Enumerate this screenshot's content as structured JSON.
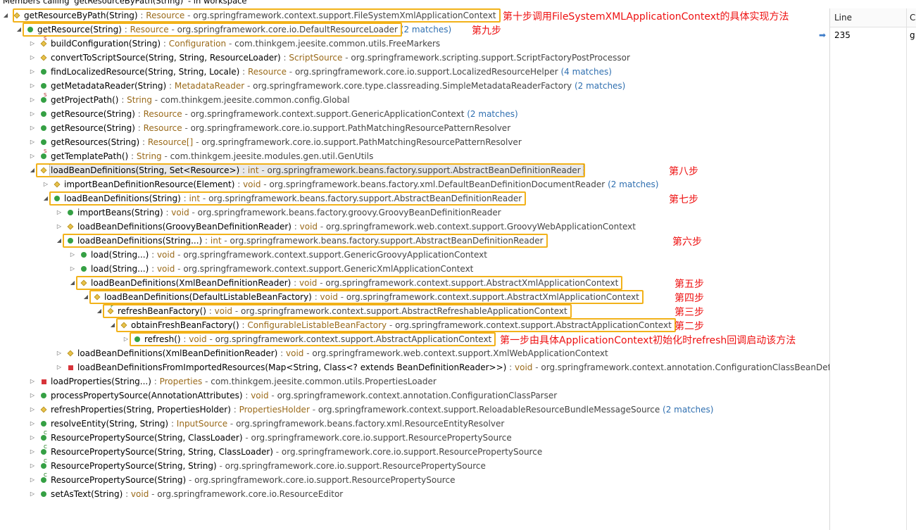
{
  "header": {
    "title": "Members calling 'getResourceByPath(String)' - in workspace"
  },
  "right_panel": {
    "col_line": "Line",
    "col_code": "C",
    "row_line": "235",
    "row_code": "g"
  },
  "rows": [
    {
      "indent": 0,
      "twisty": "open",
      "icon": "prot",
      "mod": "",
      "method": "getResourceByPath(String)",
      "ret": "Resource",
      "decl": "org.springframework.context.support.FileSystemXmlApplicationContext",
      "count": "",
      "hl": true
    },
    {
      "indent": 1,
      "twisty": "open",
      "icon": "pub",
      "mod": "",
      "method": "getResource(String)",
      "ret": "Resource",
      "decl": "org.springframework.core.io.DefaultResourceLoader",
      "count": "(2 matches)",
      "hl": true
    },
    {
      "indent": 2,
      "twisty": "closed",
      "icon": "prot",
      "mod": "S",
      "method": "buildConfiguration(String)",
      "ret": "Configuration",
      "decl": "com.thinkgem.jeesite.common.utils.FreeMarkers",
      "count": ""
    },
    {
      "indent": 2,
      "twisty": "closed",
      "icon": "prot",
      "mod": "",
      "method": "convertToScriptSource(String, String, ResourceLoader)",
      "ret": "ScriptSource",
      "decl": "org.springframework.scripting.support.ScriptFactoryPostProcessor",
      "count": ""
    },
    {
      "indent": 2,
      "twisty": "closed",
      "icon": "pub",
      "mod": "",
      "method": "findLocalizedResource(String, String, Locale)",
      "ret": "Resource",
      "decl": "org.springframework.core.io.support.LocalizedResourceHelper",
      "count": "(4 matches)"
    },
    {
      "indent": 2,
      "twisty": "closed",
      "icon": "pub",
      "mod": "",
      "method": "getMetadataReader(String)",
      "ret": "MetadataReader",
      "decl": "org.springframework.core.type.classreading.SimpleMetadataReaderFactory",
      "count": "(2 matches)"
    },
    {
      "indent": 2,
      "twisty": "closed",
      "icon": "pub",
      "mod": "S",
      "method": "getProjectPath()",
      "ret": "String",
      "decl": "com.thinkgem.jeesite.common.config.Global",
      "count": ""
    },
    {
      "indent": 2,
      "twisty": "closed",
      "icon": "pub",
      "mod": "",
      "method": "getResource(String)",
      "ret": "Resource",
      "decl": "org.springframework.context.support.GenericApplicationContext",
      "count": "(2 matches)"
    },
    {
      "indent": 2,
      "twisty": "closed",
      "icon": "pub",
      "mod": "",
      "method": "getResource(String)",
      "ret": "Resource",
      "decl": "org.springframework.core.io.support.PathMatchingResourcePatternResolver",
      "count": ""
    },
    {
      "indent": 2,
      "twisty": "closed",
      "icon": "pub",
      "mod": "",
      "method": "getResources(String)",
      "ret": "Resource[]",
      "decl": "org.springframework.core.io.support.PathMatchingResourcePatternResolver",
      "count": ""
    },
    {
      "indent": 2,
      "twisty": "closed",
      "icon": "pub",
      "mod": "S",
      "method": "getTemplatePath()",
      "ret": "String",
      "decl": "com.thinkgem.jeesite.modules.gen.util.GenUtils",
      "count": ""
    },
    {
      "indent": 2,
      "twisty": "open",
      "icon": "prot",
      "mod": "",
      "method": "loadBeanDefinitions(String, Set<Resource>)",
      "ret": "int",
      "decl": "org.springframework.beans.factory.support.AbstractBeanDefinitionReader",
      "count": "",
      "hl": true,
      "sel": true
    },
    {
      "indent": 3,
      "twisty": "closed",
      "icon": "prot",
      "mod": "",
      "method": "importBeanDefinitionResource(Element)",
      "ret": "void",
      "decl": "org.springframework.beans.factory.xml.DefaultBeanDefinitionDocumentReader",
      "count": "(2 matches)"
    },
    {
      "indent": 3,
      "twisty": "open",
      "icon": "pub",
      "mod": "",
      "method": "loadBeanDefinitions(String)",
      "ret": "int",
      "decl": "org.springframework.beans.factory.support.AbstractBeanDefinitionReader",
      "count": "",
      "hl": true
    },
    {
      "indent": 4,
      "twisty": "closed",
      "icon": "pub",
      "mod": "",
      "method": "importBeans(String)",
      "ret": "void",
      "decl": "org.springframework.beans.factory.groovy.GroovyBeanDefinitionReader",
      "count": ""
    },
    {
      "indent": 4,
      "twisty": "closed",
      "icon": "prot",
      "mod": "",
      "method": "loadBeanDefinitions(GroovyBeanDefinitionReader)",
      "ret": "void",
      "decl": "org.springframework.web.context.support.GroovyWebApplicationContext",
      "count": ""
    },
    {
      "indent": 4,
      "twisty": "open",
      "icon": "pub",
      "mod": "",
      "method": "loadBeanDefinitions(String...)",
      "ret": "int",
      "decl": "org.springframework.beans.factory.support.AbstractBeanDefinitionReader",
      "count": "",
      "hl": true
    },
    {
      "indent": 5,
      "twisty": "closed",
      "icon": "pub",
      "mod": "",
      "method": "load(String...)",
      "ret": "void",
      "decl": "org.springframework.context.support.GenericGroovyApplicationContext",
      "count": ""
    },
    {
      "indent": 5,
      "twisty": "closed",
      "icon": "pub",
      "mod": "",
      "method": "load(String...)",
      "ret": "void",
      "decl": "org.springframework.context.support.GenericXmlApplicationContext",
      "count": ""
    },
    {
      "indent": 5,
      "twisty": "open",
      "icon": "prot",
      "mod": "",
      "method": "loadBeanDefinitions(XmlBeanDefinitionReader)",
      "ret": "void",
      "decl": "org.springframework.context.support.AbstractXmlApplicationContext",
      "count": "",
      "hl": true
    },
    {
      "indent": 6,
      "twisty": "open",
      "icon": "prot",
      "mod": "",
      "method": "loadBeanDefinitions(DefaultListableBeanFactory)",
      "ret": "void",
      "decl": "org.springframework.context.support.AbstractXmlApplicationContext",
      "count": "",
      "hl": true
    },
    {
      "indent": 7,
      "twisty": "open",
      "icon": "prot",
      "mod": "F",
      "method": "refreshBeanFactory()",
      "ret": "void",
      "decl": "org.springframework.context.support.AbstractRefreshableApplicationContext",
      "count": "",
      "hl": true
    },
    {
      "indent": 8,
      "twisty": "open",
      "icon": "prot",
      "mod": "",
      "method": "obtainFreshBeanFactory()",
      "ret": "ConfigurableListableBeanFactory",
      "decl": "org.springframework.context.support.AbstractApplicationContext",
      "count": "",
      "hl": true
    },
    {
      "indent": 9,
      "twisty": "closed",
      "icon": "pub",
      "mod": "",
      "method": "refresh()",
      "ret": "void",
      "decl": "org.springframework.context.support.AbstractApplicationContext",
      "count": "",
      "hl": true
    },
    {
      "indent": 4,
      "twisty": "closed",
      "icon": "prot",
      "mod": "",
      "method": "loadBeanDefinitions(XmlBeanDefinitionReader)",
      "ret": "void",
      "decl": "org.springframework.web.context.support.XmlWebApplicationContext",
      "count": ""
    },
    {
      "indent": 4,
      "twisty": "closed",
      "icon": "priv",
      "mod": "",
      "method": "loadBeanDefinitionsFromImportedResources(Map<String, Class<? extends BeanDefinitionReader>>)",
      "ret": "void",
      "decl": "org.springframework.context.annotation.ConfigurationClassBeanDefi",
      "count": ""
    },
    {
      "indent": 2,
      "twisty": "closed",
      "icon": "priv",
      "mod": "",
      "method": "loadProperties(String...)",
      "ret": "Properties",
      "decl": "com.thinkgem.jeesite.common.utils.PropertiesLoader",
      "count": ""
    },
    {
      "indent": 2,
      "twisty": "closed",
      "icon": "pub",
      "mod": "",
      "method": "processPropertySource(AnnotationAttributes)",
      "ret": "void",
      "decl": "org.springframework.context.annotation.ConfigurationClassParser",
      "count": ""
    },
    {
      "indent": 2,
      "twisty": "closed",
      "icon": "prot",
      "mod": "",
      "method": "refreshProperties(String, PropertiesHolder)",
      "ret": "PropertiesHolder",
      "decl": "org.springframework.context.support.ReloadableResourceBundleMessageSource",
      "count": "(2 matches)"
    },
    {
      "indent": 2,
      "twisty": "closed",
      "icon": "pub",
      "mod": "",
      "method": "resolveEntity(String, String)",
      "ret": "InputSource",
      "decl": "org.springframework.beans.factory.xml.ResourceEntityResolver",
      "count": ""
    },
    {
      "indent": 2,
      "twisty": "closed",
      "icon": "pub",
      "mod": "C",
      "method": "ResourcePropertySource(String, ClassLoader)",
      "ret": "",
      "decl": "org.springframework.core.io.support.ResourcePropertySource",
      "count": ""
    },
    {
      "indent": 2,
      "twisty": "closed",
      "icon": "pub",
      "mod": "C",
      "method": "ResourcePropertySource(String, String, ClassLoader)",
      "ret": "",
      "decl": "org.springframework.core.io.support.ResourcePropertySource",
      "count": ""
    },
    {
      "indent": 2,
      "twisty": "closed",
      "icon": "pub",
      "mod": "C",
      "method": "ResourcePropertySource(String, String)",
      "ret": "",
      "decl": "org.springframework.core.io.support.ResourcePropertySource",
      "count": ""
    },
    {
      "indent": 2,
      "twisty": "closed",
      "icon": "pub",
      "mod": "C",
      "method": "ResourcePropertySource(String)",
      "ret": "",
      "decl": "org.springframework.core.io.support.ResourcePropertySource",
      "count": ""
    },
    {
      "indent": 2,
      "twisty": "closed",
      "icon": "pub",
      "mod": "",
      "method": "setAsText(String)",
      "ret": "void",
      "decl": "org.springframework.core.io.ResourceEditor",
      "count": ""
    }
  ],
  "annotations": [
    {
      "row": 0,
      "text": "第十步调用FileSystemXMLApplicationContext的具体实现方法"
    },
    {
      "row": 1,
      "text": "第九步"
    },
    {
      "row": 11,
      "text": "第八步"
    },
    {
      "row": 13,
      "text": "第七步"
    },
    {
      "row": 16,
      "text": "第六步"
    },
    {
      "row": 19,
      "text": "第五步"
    },
    {
      "row": 20,
      "text": "第四步"
    },
    {
      "row": 21,
      "text": "第三步"
    },
    {
      "row": 22,
      "text": "第二步"
    },
    {
      "row": 23,
      "text": "第一步由具体ApplicationContext初始化时refresh回调启动该方法"
    }
  ],
  "colors": {
    "highlight_border": "#f2b21a",
    "annotation": "#ee1111",
    "public_icon": "#35a044",
    "protected_icon": "#e8c24a",
    "private_icon": "#d7343a",
    "match_count": "#2f6fb0",
    "return_type": "#9a6a1a"
  }
}
